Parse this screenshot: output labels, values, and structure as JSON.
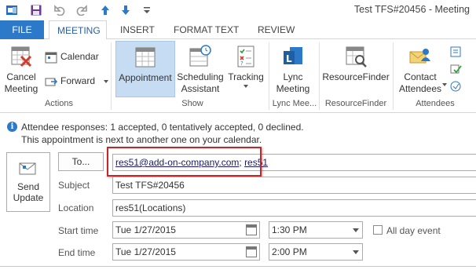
{
  "window": {
    "title": "Test TFS#20456 - Meeting"
  },
  "tabs": [
    "FILE",
    "MEETING",
    "INSERT",
    "FORMAT TEXT",
    "REVIEW"
  ],
  "ribbon": {
    "actions": {
      "cancel_meeting": "Cancel Meeting",
      "calendar": "Calendar",
      "forward": "Forward",
      "label": "Actions"
    },
    "show": {
      "appointment": "Appointment",
      "scheduling_assistant": "Scheduling Assistant",
      "tracking": "Tracking",
      "label": "Show"
    },
    "lync": {
      "lync_meeting": "Lync Meeting",
      "label": "Lync Mee..."
    },
    "resourcefinder": {
      "button": "ResourceFinder",
      "label": "ResourceFinder"
    },
    "attendees": {
      "contact_attendees": "Contact Attendees",
      "label": "Attendees"
    }
  },
  "info": {
    "line1": "Attendee responses: 1 accepted, 0 tentatively accepted, 0 declined.",
    "line2": "This appointment is next to another one on your calendar."
  },
  "form": {
    "send_update": "Send Update",
    "to_button": "To...",
    "to_recipients": [
      "res51@add-on-company.com",
      "res51"
    ],
    "to_separator": ";",
    "subject_label": "Subject",
    "subject_value": "Test TFS#20456",
    "location_label": "Location",
    "location_value": "res51(Locations)",
    "start_label": "Start time",
    "start_date": "Tue 1/27/2015",
    "start_time": "1:30 PM",
    "end_label": "End time",
    "end_date": "Tue 1/27/2015",
    "end_time": "2:00 PM",
    "all_day_label": "All day event"
  },
  "colors": {
    "accent": "#2b79c8",
    "highlight": "#c5dcf2",
    "callout": "#c0282d"
  }
}
